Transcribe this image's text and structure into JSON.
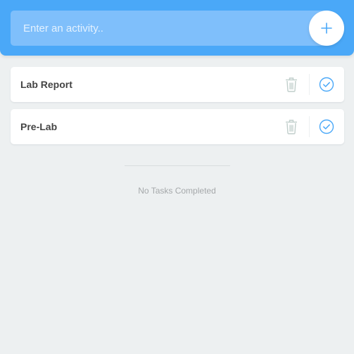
{
  "input": {
    "placeholder": "Enter an activity.."
  },
  "add_button_icon": "plus-icon",
  "colors": {
    "header": "#4aa8f8",
    "accent": "#4aa8f8",
    "trash": "#c0cecb",
    "background": "#edf0f1"
  },
  "todos": [
    {
      "text": "Lab Report",
      "remove_icon": "trash-icon",
      "complete_icon": "check-circle-icon"
    },
    {
      "text": "Pre-Lab",
      "remove_icon": "trash-icon",
      "complete_icon": "check-circle-icon"
    }
  ],
  "completed": {
    "empty_text": "No Tasks Completed"
  }
}
